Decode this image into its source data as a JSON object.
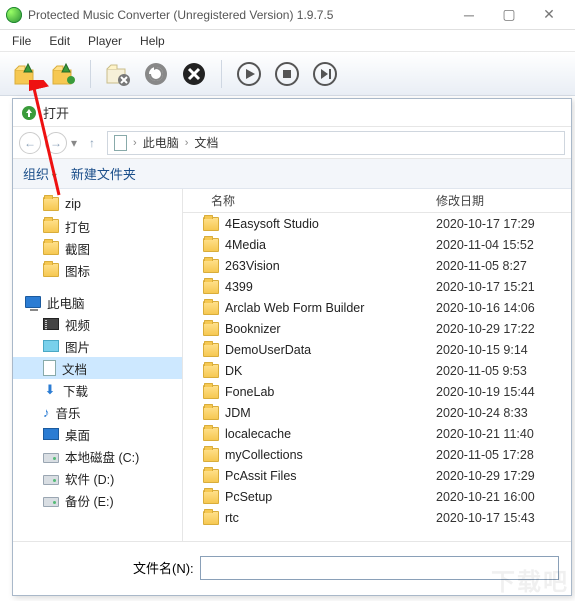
{
  "window": {
    "title": "Protected Music Converter  (Unregistered Version) 1.9.7.5"
  },
  "menu": {
    "file": "File",
    "edit": "Edit",
    "player": "Player",
    "help": "Help"
  },
  "dialog": {
    "title": "打开",
    "path_root": "此电脑",
    "path_current": "文档",
    "cmd_organize": "组织",
    "cmd_newfolder": "新建文件夹",
    "filename_label": "文件名(N):",
    "filename_value": "",
    "col_name": "名称",
    "col_date": "修改日期"
  },
  "tree": {
    "zip": "zip",
    "dabao": "打包",
    "jietu": "截图",
    "tubiao": "图标",
    "pc": "此电脑",
    "video": "视频",
    "pic": "图片",
    "doc": "文档",
    "dl": "下载",
    "music": "音乐",
    "desk": "桌面",
    "driveC": "本地磁盘 (C:)",
    "driveD": "软件 (D:)",
    "driveE": "备份 (E:)"
  },
  "files": [
    {
      "name": "4Easysoft Studio",
      "date": "2020-10-17 17:29"
    },
    {
      "name": "4Media",
      "date": "2020-11-04 15:52"
    },
    {
      "name": "263Vision",
      "date": "2020-11-05 8:27"
    },
    {
      "name": "4399",
      "date": "2020-10-17 15:21"
    },
    {
      "name": "Arclab Web Form Builder",
      "date": "2020-10-16 14:06"
    },
    {
      "name": "Booknizer",
      "date": "2020-10-29 17:22"
    },
    {
      "name": "DemoUserData",
      "date": "2020-10-15 9:14"
    },
    {
      "name": "DK",
      "date": "2020-11-05 9:53"
    },
    {
      "name": "FoneLab",
      "date": "2020-10-19 15:44"
    },
    {
      "name": "JDM",
      "date": "2020-10-24 8:33"
    },
    {
      "name": "localecache",
      "date": "2020-10-21 11:40"
    },
    {
      "name": "myCollections",
      "date": "2020-11-05 17:28"
    },
    {
      "name": "PcAssit Files",
      "date": "2020-10-29 17:29"
    },
    {
      "name": "PcSetup",
      "date": "2020-10-21 16:00"
    },
    {
      "name": "rtc",
      "date": "2020-10-17 15:43"
    }
  ],
  "watermark": "下载吧"
}
